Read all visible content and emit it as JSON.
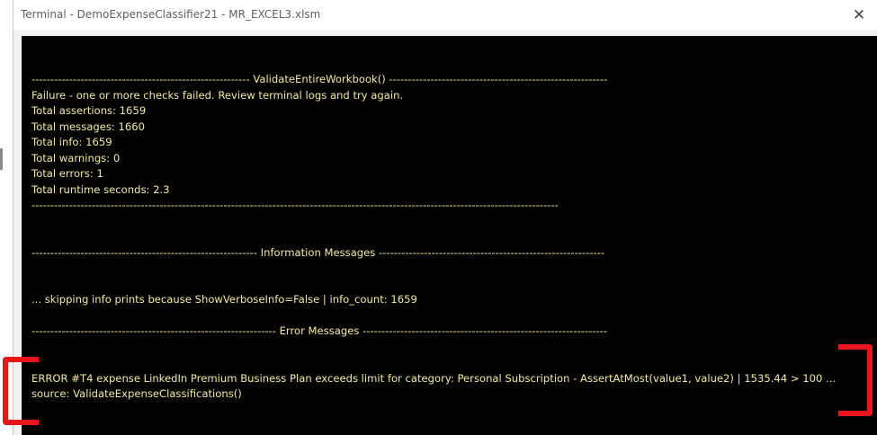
{
  "window": {
    "title": "Terminal - DemoExpenseClassifier21 - MR_EXCEL3.xlsm",
    "close_glyph": "✕"
  },
  "terminal": {
    "validate_header": "---------------------------------------------------------- ValidateEntireWorkbook() ----------------------------------------------------------",
    "failure_line": "Failure - one or more checks failed. Review terminal logs and try again.",
    "total_assertions": "Total assertions: 1659",
    "total_messages": "Total messages: 1660",
    "total_info": "Total info: 1659",
    "total_warnings": "Total warnings: 0",
    "total_errors": "Total errors: 1",
    "total_runtime": "Total runtime seconds: 2.3",
    "validate_footer": "--------------------------------------------------------------------------------------------------------------------------------------------",
    "info_header": "------------------------------------------------------------ Information Messages ------------------------------------------------------------",
    "info_skip_line": "... skipping info prints because ShowVerboseInfo=False | info_count: 1659",
    "error_header": "----------------------------------------------------------------- Error Messages -----------------------------------------------------------------",
    "error_line": "ERROR #T4 expense LinkedIn Premium Business Plan exceeds limit for category: Personal Subscription - AssertAtMost(value1, value2) | 1535.44 > 100 ...",
    "error_source": "source: ValidateExpenseClassifications()"
  },
  "annotations": {
    "bracket_color": "#e8161b"
  }
}
